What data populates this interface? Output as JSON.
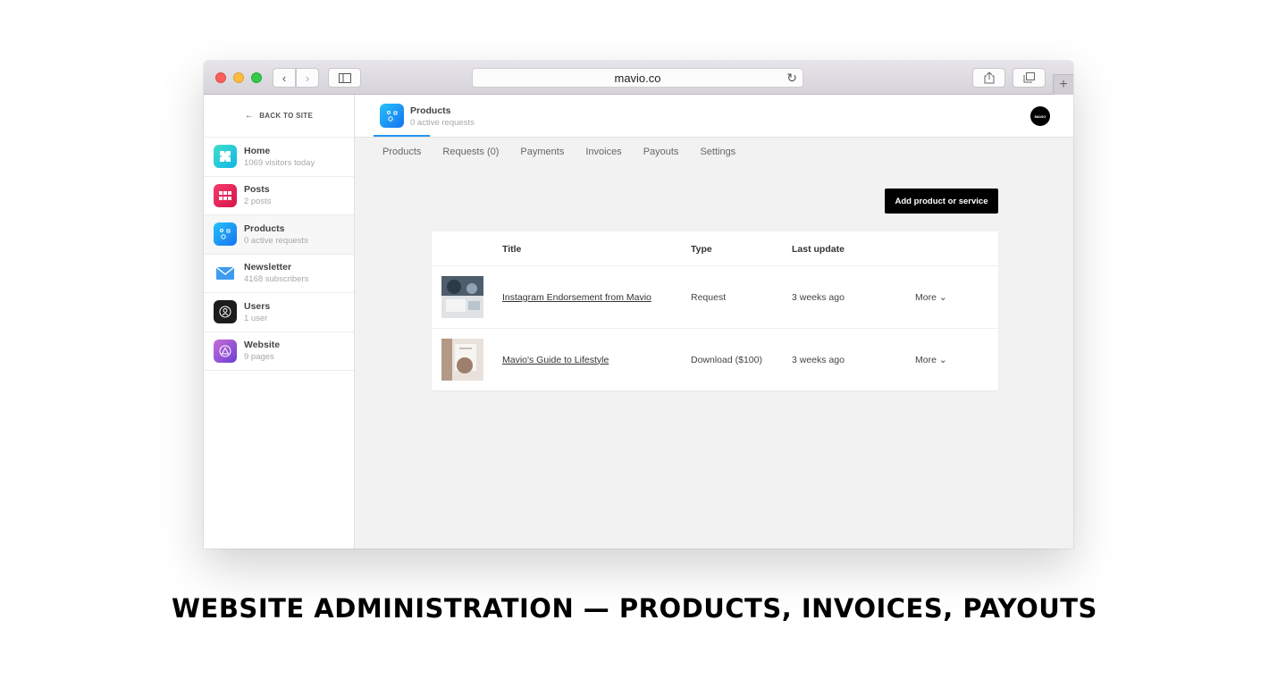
{
  "browser": {
    "url": "mavio.co"
  },
  "sidebar": {
    "back_label": "BACK TO SITE",
    "items": [
      {
        "title": "Home",
        "subtitle": "1069 visitors today"
      },
      {
        "title": "Posts",
        "subtitle": "2 posts"
      },
      {
        "title": "Products",
        "subtitle": "0 active requests"
      },
      {
        "title": "Newsletter",
        "subtitle": "4168 subscribers"
      },
      {
        "title": "Users",
        "subtitle": "1 user"
      },
      {
        "title": "Website",
        "subtitle": "9 pages"
      }
    ]
  },
  "header": {
    "title": "Products",
    "subtitle": "0 active requests",
    "avatar_text": "MAVIO"
  },
  "tabs": [
    "Products",
    "Requests (0)",
    "Payments",
    "Invoices",
    "Payouts",
    "Settings"
  ],
  "actions": {
    "add_label": "Add product or service"
  },
  "table": {
    "columns": [
      "Title",
      "Type",
      "Last update"
    ],
    "rows": [
      {
        "title": "Instagram Endorsement from Mavio",
        "type": "Request",
        "updated": "3 weeks ago",
        "more": "More ⌄"
      },
      {
        "title": "Mavio's Guide to Lifestyle",
        "type": "Download ($100)",
        "updated": "3 weeks ago",
        "more": "More ⌄"
      }
    ]
  },
  "caption": "WEBSITE ADMINISTRATION — PRODUCTS, INVOICES, PAYOUTS"
}
